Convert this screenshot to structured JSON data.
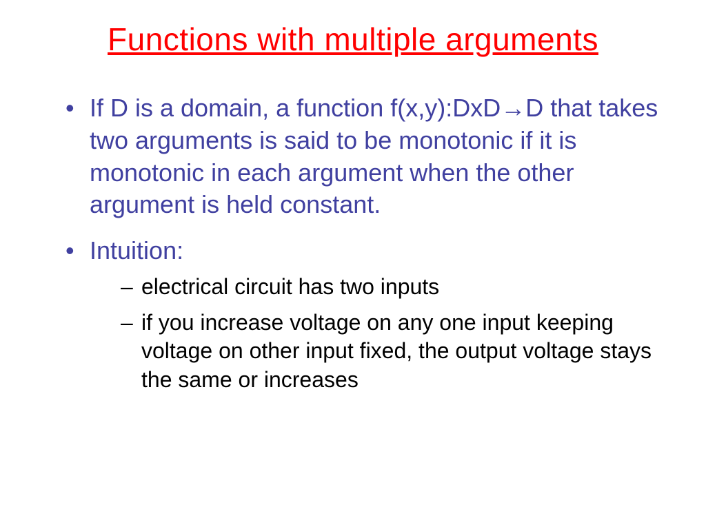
{
  "slide": {
    "title": "Functions with multiple arguments",
    "bullets": [
      {
        "text_before_arrow": "If D is a domain, a function f(x,y):DxD",
        "arrow": "→",
        "text_after_arrow": "D that takes two arguments is said to be monotonic if it is monotonic in each argument when the other argument is held constant."
      },
      {
        "text": "Intuition:",
        "subitems": [
          "electrical circuit has two inputs",
          "if you increase voltage on any one input keeping voltage on other input fixed, the output voltage stays the same or increases"
        ]
      }
    ]
  }
}
